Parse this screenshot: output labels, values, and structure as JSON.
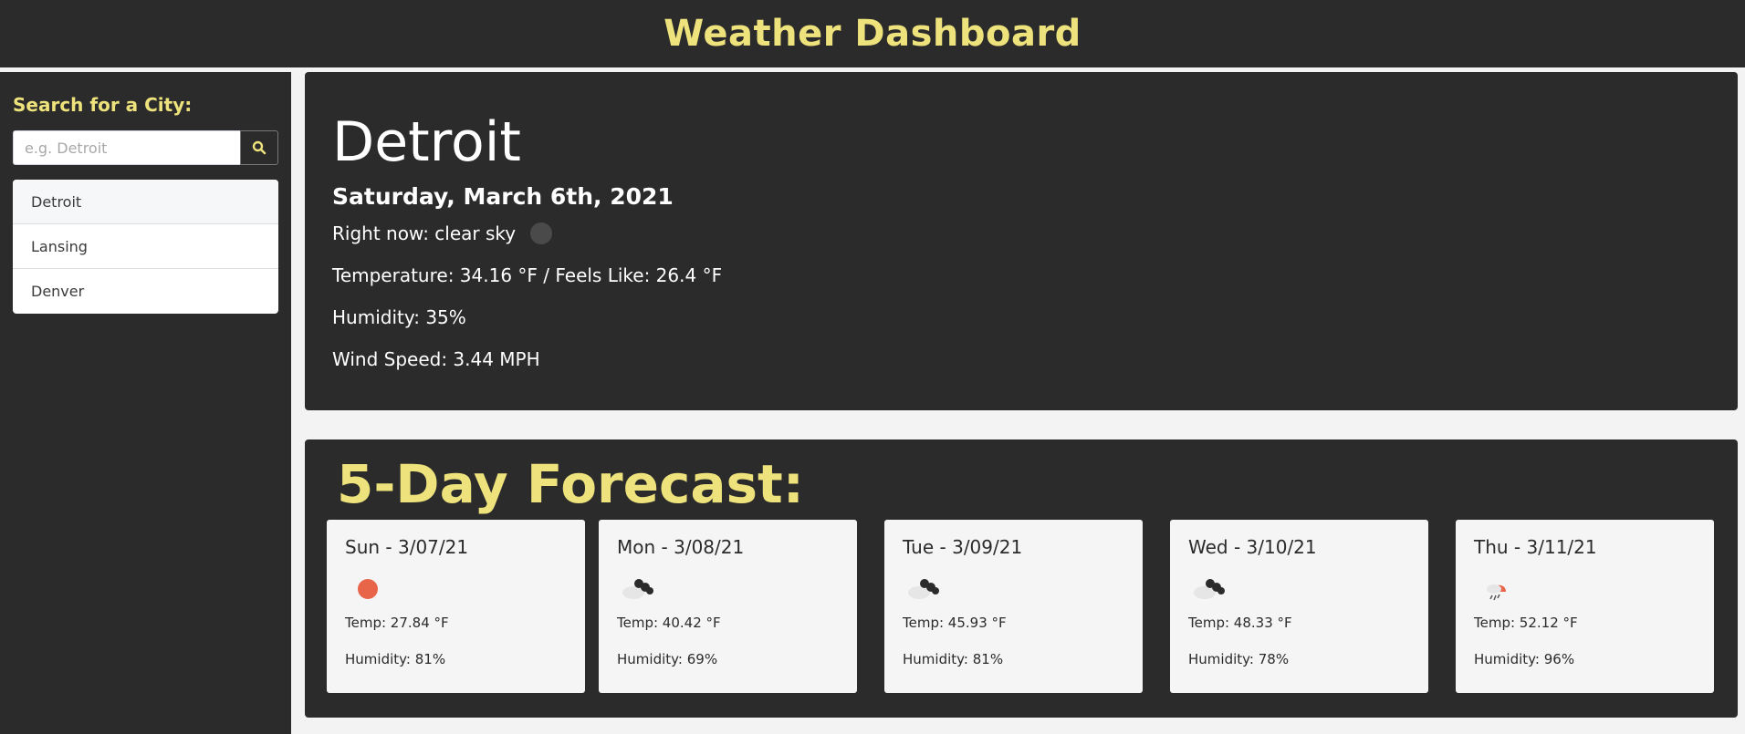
{
  "header": {
    "title": "Weather Dashboard"
  },
  "sidebar": {
    "search_label": "Search for a City:",
    "search_placeholder": "e.g. Detroit",
    "search_icon": "search-icon",
    "cities": [
      {
        "label": "Detroit",
        "active": true
      },
      {
        "label": "Lansing",
        "active": false
      },
      {
        "label": "Denver",
        "active": false
      }
    ]
  },
  "current": {
    "city": "Detroit",
    "date": "Saturday, March 6th, 2021",
    "right_now": "Right now: clear sky",
    "weather_icon": "clear-night-icon",
    "temperature": "Temperature: 34.16 °F / Feels Like: 26.4 °F",
    "humidity": "Humidity: 35%",
    "wind": "Wind Speed: 3.44 MPH"
  },
  "forecast": {
    "title": "5-Day Forecast:",
    "days": [
      {
        "day": "Sun - 3/07/21",
        "icon": "sun-icon",
        "temp": "Temp: 27.84 °F",
        "humidity": "Humidity: 81%"
      },
      {
        "day": "Mon - 3/08/21",
        "icon": "broken-clouds-icon",
        "temp": "Temp: 40.42 °F",
        "humidity": "Humidity: 69%"
      },
      {
        "day": "Tue - 3/09/21",
        "icon": "broken-clouds-icon",
        "temp": "Temp: 45.93 °F",
        "humidity": "Humidity: 81%"
      },
      {
        "day": "Wed - 3/10/21",
        "icon": "broken-clouds-icon",
        "temp": "Temp: 48.33 °F",
        "humidity": "Humidity: 78%"
      },
      {
        "day": "Thu - 3/11/21",
        "icon": "rain-sun-icon",
        "temp": "Temp: 52.12 °F",
        "humidity": "Humidity: 96%"
      }
    ]
  },
  "colors": {
    "accent": "#ede27b",
    "panel": "#2b2b2b",
    "background": "#f3f3f3",
    "sun": "#e8654a"
  }
}
